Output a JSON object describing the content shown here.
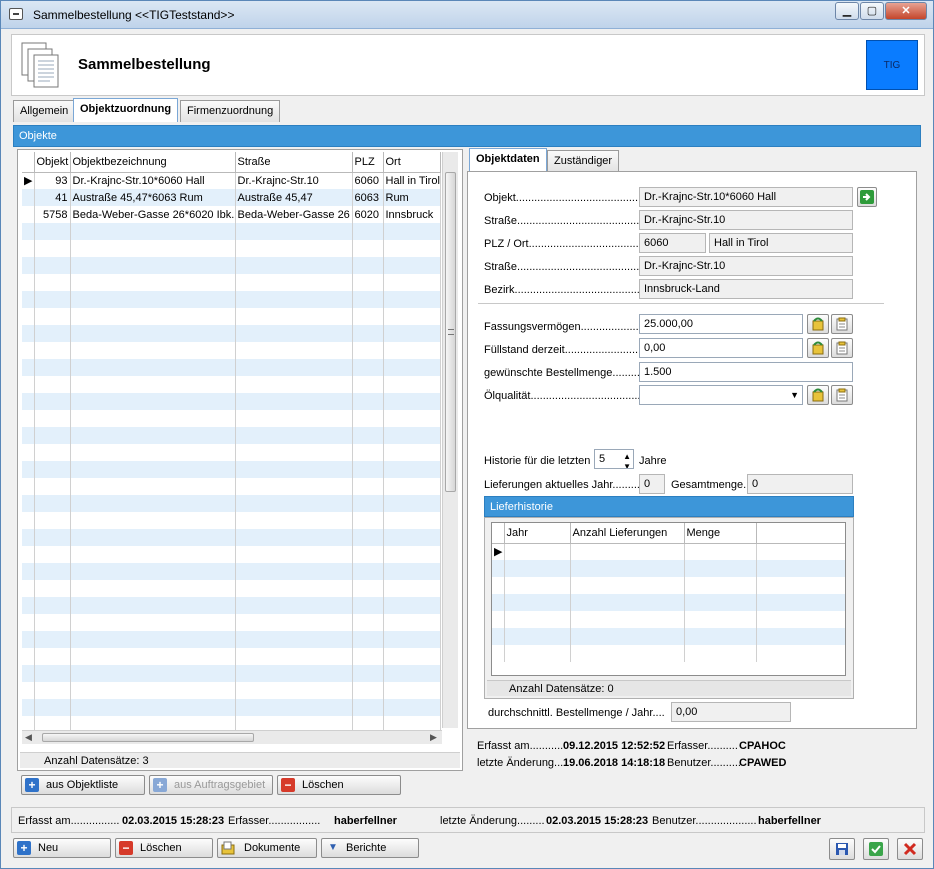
{
  "window": {
    "title": "Sammelbestellung <<TIGTeststand>>"
  },
  "header": {
    "title": "Sammelbestellung",
    "badge": "TIG",
    "badge_color": "#0a7cff"
  },
  "tabs": [
    "Allgemein",
    "Objektzuordnung",
    "Firmenzuordnung"
  ],
  "objekte": {
    "title": "Objekte",
    "columns": [
      "Objekt",
      "Objektbezeichnung",
      "Straße",
      "PLZ",
      "Ort"
    ],
    "rows": [
      [
        "93",
        "Dr.-Krajnc-Str.10*6060 Hall",
        "Dr.-Krajnc-Str.10",
        "6060",
        "Hall in Tirol"
      ],
      [
        "41",
        "Austraße 45,47*6063 Rum",
        "Austraße 45,47",
        "6063",
        "Rum"
      ],
      [
        "5758",
        "Beda-Weber-Gasse 26*6020 Ibk.",
        "Beda-Weber-Gasse 26",
        "6020",
        "Innsbruck"
      ]
    ],
    "record_count": "Anzahl Datensätze: 3",
    "buttons": {
      "add_list": "aus Objektliste",
      "add_order": "aus Auftragsgebiet",
      "delete": "Löschen"
    }
  },
  "detail_tabs": [
    "Objektdaten",
    "Zuständiger"
  ],
  "objektdaten": {
    "objekt_label": "Objekt............................................",
    "objekt_value": "Dr.-Krajnc-Str.10*6060 Hall",
    "strasse_label": "Straße............................................",
    "strasse_value": "Dr.-Krajnc-Str.10",
    "plzort_label": "PLZ / Ort.........................................",
    "plz_value": "6060",
    "ort_value": "Hall in Tirol",
    "strasse2_label": "Straße............................................",
    "strasse2_value": "Dr.-Krajnc-Str.10",
    "bezirk_label": "Bezirk.............................................",
    "bezirk_value": "Innsbruck-Land",
    "fassung_label": "Fassungsvermögen............................",
    "fassung_value": "25.000,00",
    "fuell_label": "Füllstand derzeit.............................",
    "fuell_value": "0,00",
    "bestell_label": "gewünschte Bestellmenge..........",
    "bestell_value": "1.500",
    "oel_label": "Ölqualität........................................",
    "oel_value": "",
    "historie_label": "Historie für die letzten",
    "historie_value": "5",
    "jahre_label": "Jahre",
    "lief_label": "Lieferungen aktuelles Jahr.............",
    "lief_value": "0",
    "gesamt_label": "Gesamtmenge..",
    "gesamt_value": "0",
    "lieferhistorie_title": "Lieferhistorie",
    "lh_columns": [
      "Jahr",
      "Anzahl Lieferungen",
      "Menge"
    ],
    "lh_count": "Anzahl Datensätze: 0",
    "avg_label": "durchschnittl. Bestellmenge / Jahr....",
    "avg_value": "0,00",
    "erfasst": "Erfasst am...........",
    "erfasst_date": "09.12.2015 12:52:52",
    "erfasser": "Erfasser..........",
    "erfasser_name": "CPAHOC",
    "aenderung": "letzte Änderung....",
    "aenderung_date": "19.06.2018 14:18:18",
    "benutzer": "Benutzer..........",
    "benutzer_name": "CPAWED"
  },
  "footer": {
    "erfasst": "Erfasst am................",
    "erfasst_date": "02.03.2015 15:28:23",
    "erfasser": "Erfasser.................",
    "erfasser_name": "haberfellner",
    "aenderung": "letzte Änderung.........",
    "aenderung_date": "02.03.2015 15:28:23",
    "benutzer": "Benutzer....................",
    "benutzer_name": "haberfellner"
  },
  "toolbar": {
    "new": "Neu",
    "delete": "Löschen",
    "documents": "Dokumente",
    "reports": "Berichte"
  }
}
